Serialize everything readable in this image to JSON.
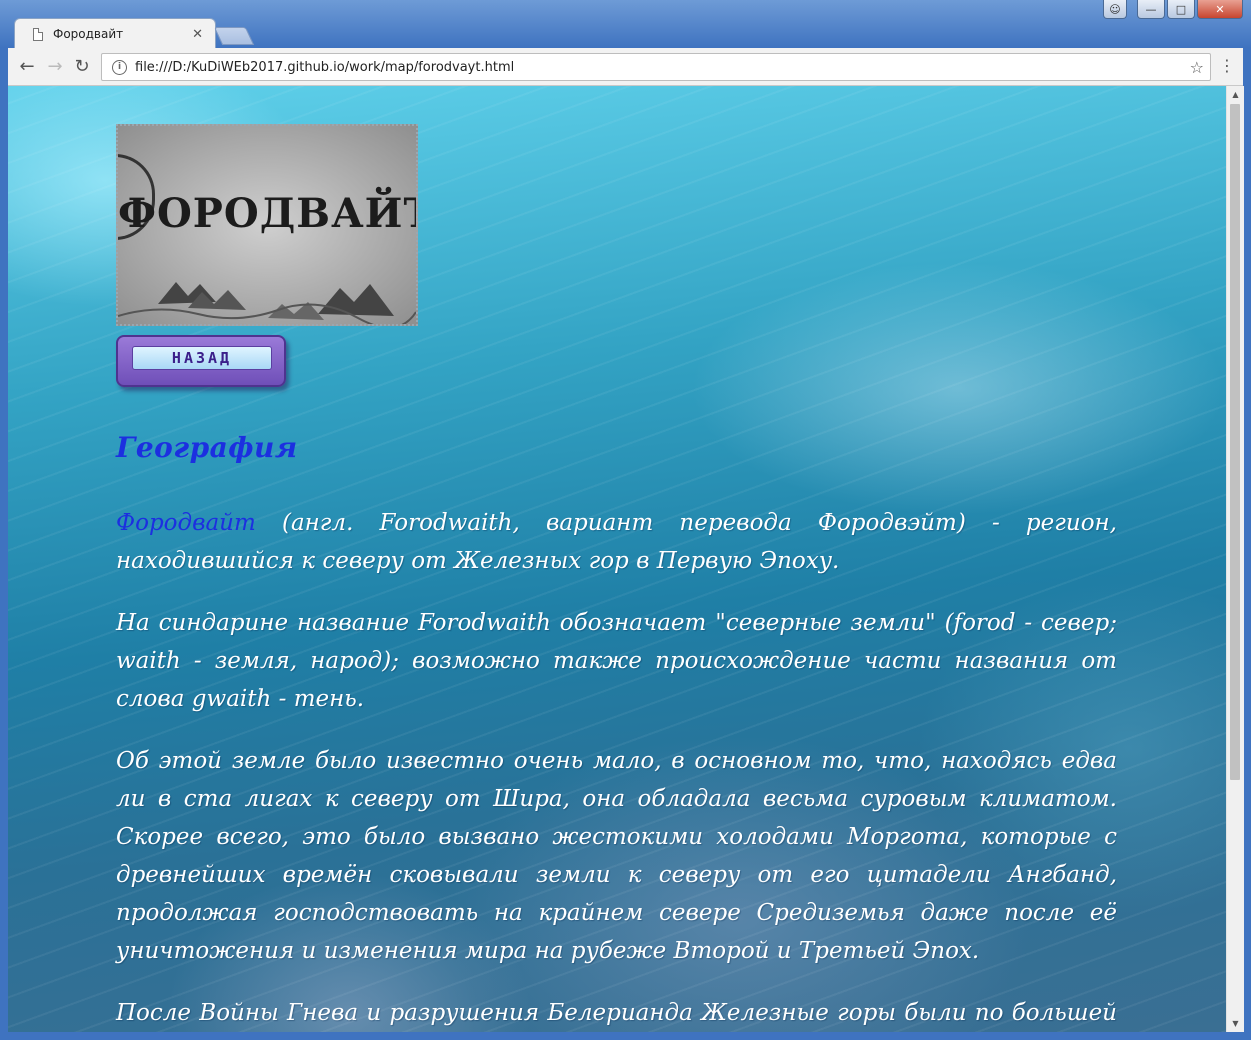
{
  "browser": {
    "tab_title": "Фородвайт",
    "url": "file:///D:/KuDiWEb2017.github.io/work/map/forodvayt.html"
  },
  "page": {
    "logo_text": "ФОРОДВАЙТ",
    "back_button_label": "НАЗАД",
    "heading": "География",
    "paragraph1_term": "Фородвайт",
    "paragraph1_text": " (англ. Forodwaith, вариант перевода Фородвэйт) - регион, находившийся к северу от Железных гор в Первую Эпоху.",
    "paragraph2": "На синдарине название Forodwaith обозначает \"северные земли\" (forod - север; waith - земля, народ); возможно также происхождение части названия от слова gwaith - тень.",
    "paragraph3": "Об этой земле было известно очень мало, в основном то, что, находясь едва ли в ста лигах к северу от Шира, она обладала весьма суровым климатом. Скорее всего, это было вызвано жестокими холодами Моргота, которые с древнейших времён сковывали земли к северу от его цитадели Ангбанд, продолжая господствовать на крайнем севере Средиземья даже после её уничтожения и изменения мира на рубеже Второй и Третьей Эпох.",
    "paragraph4": "После Войны Гнева и разрушения Белерианда Железные горы были по большей части"
  }
}
